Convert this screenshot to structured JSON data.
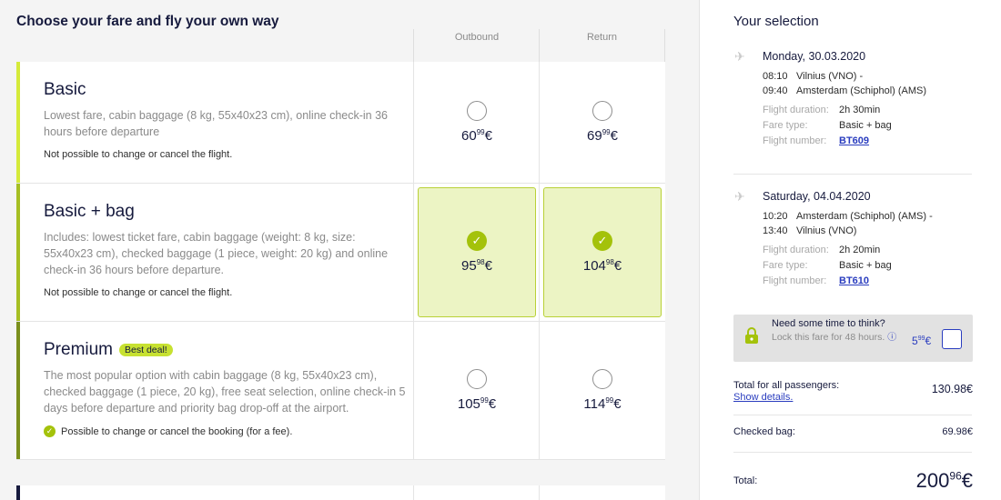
{
  "page": {
    "title": "Choose your fare and fly your own way",
    "columns": {
      "outbound": "Outbound",
      "return": "Return"
    }
  },
  "colors": {
    "accent_lime": "#c7e131",
    "check_green": "#a4c20b",
    "selected_bg": "#ecf4c4",
    "link_blue": "#2a3dbf",
    "navy": "#161a3d",
    "bar_basic": "#d5ea3a",
    "bar_basic_bag": "#a6bf23",
    "bar_premium": "#7a8f1c"
  },
  "fares": [
    {
      "name": "Basic",
      "description": "Lowest fare, cabin baggage (8 kg, 55x40x23 cm), online check-in 36 hours before departure",
      "note": "Not possible to change or cancel the flight.",
      "outbound": {
        "whole": "60",
        "cents": "99",
        "currency": "€",
        "selected": false
      },
      "return": {
        "whole": "69",
        "cents": "99",
        "currency": "€",
        "selected": false
      }
    },
    {
      "name": "Basic + bag",
      "description": "Includes: lowest ticket fare, cabin baggage (weight: 8 kg, size: 55x40x23 cm), checked baggage (1 piece, weight: 20 kg) and online check-in 36 hours before departure.",
      "note": "Not possible to change or cancel the flight.",
      "outbound": {
        "whole": "95",
        "cents": "98",
        "currency": "€",
        "selected": true
      },
      "return": {
        "whole": "104",
        "cents": "98",
        "currency": "€",
        "selected": true
      }
    },
    {
      "name": "Premium",
      "badge": "Best deal!",
      "description": "The most popular option with cabin baggage (8 kg, 55x40x23 cm), checked baggage (1 piece, 20 kg), free seat selection, online check-in 5 days before departure and priority bag drop-off at the airport.",
      "note": "Possible to change or cancel the booking (for a fee).",
      "outbound": {
        "whole": "105",
        "cents": "99",
        "currency": "€",
        "selected": false
      },
      "return": {
        "whole": "114",
        "cents": "99",
        "currency": "€",
        "selected": false
      }
    }
  ],
  "selection": {
    "title": "Your selection",
    "flights": [
      {
        "date": "Monday, 30.03.2020",
        "dep_time": "08:10",
        "dep_place": "Vilnius (VNO) -",
        "arr_time": "09:40",
        "arr_place": "Amsterdam (Schiphol) (AMS)",
        "duration_label": "Flight duration:",
        "duration": "2h 30min",
        "fare_type_label": "Fare type:",
        "fare_type": "Basic + bag",
        "flight_number_label": "Flight number:",
        "flight_number": "BT609"
      },
      {
        "date": "Saturday, 04.04.2020",
        "dep_time": "10:20",
        "dep_place": "Amsterdam (Schiphol) (AMS) -",
        "arr_time": "13:40",
        "arr_place": "Vilnius (VNO)",
        "duration_label": "Flight duration:",
        "duration": "2h 20min",
        "fare_type_label": "Fare type:",
        "fare_type": "Basic + bag",
        "flight_number_label": "Flight number:",
        "flight_number": "BT610"
      }
    ],
    "lock": {
      "title": "Need some time to think?",
      "description": "Lock this fare for 48 hours.",
      "price_whole": "5",
      "price_cents": "99",
      "currency": "€"
    },
    "total_passengers_label": "Total for all passengers:",
    "show_details": "Show details.",
    "total_passengers_value": "130.98€",
    "checked_bag_label": "Checked bag:",
    "checked_bag_value": "69.98€",
    "total_label": "Total:",
    "total_whole": "200",
    "total_cents": "96",
    "total_currency": "€"
  }
}
